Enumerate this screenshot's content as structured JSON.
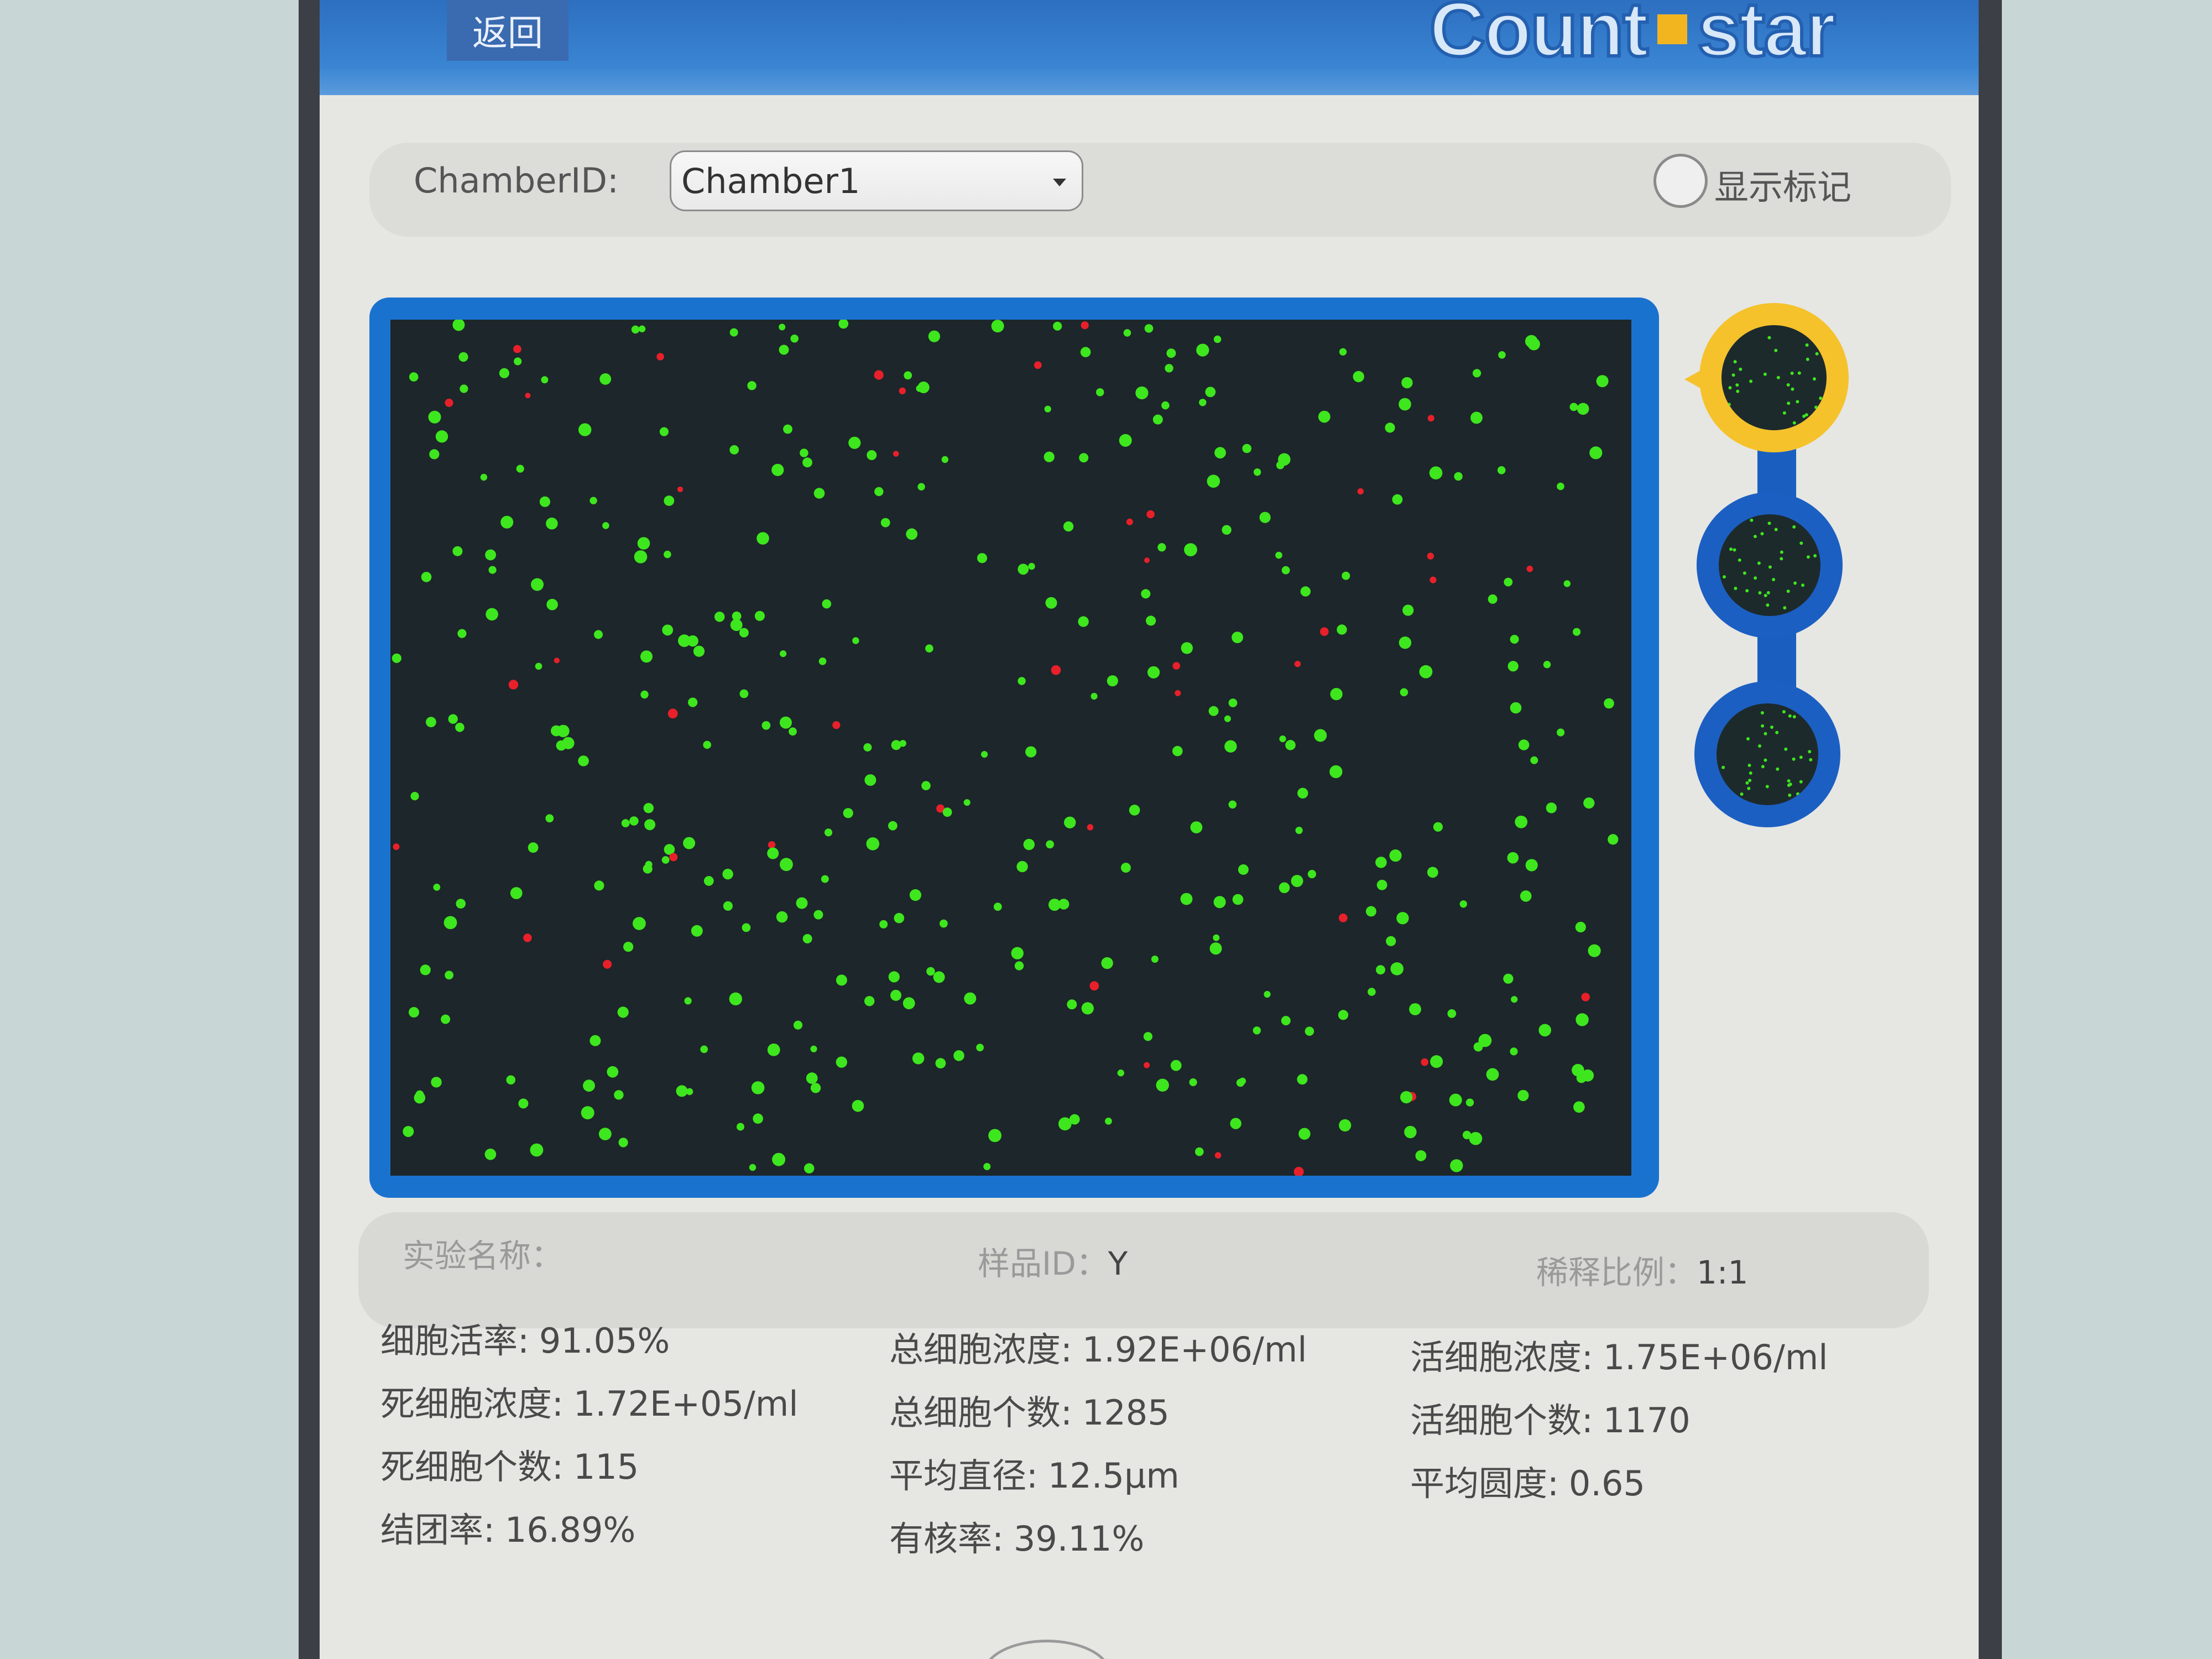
{
  "header": {
    "back_label": "返回",
    "brand_part1": "Count",
    "brand_part2": "star"
  },
  "chamber": {
    "label": "ChamberID:",
    "selected": "Chamber1",
    "show_marks_label": "显示标记",
    "show_marks_checked": false
  },
  "experiment": {
    "name_label": "实验名称：",
    "name_value": "",
    "sample_label": "样品ID：",
    "sample_value": "Y",
    "dilution_label": "稀释比例：",
    "dilution_value": "1:1"
  },
  "results": {
    "col1": [
      {
        "label": "细胞活率:",
        "value": "91.05%"
      },
      {
        "label": "死细胞浓度:",
        "value": "1.72E+05/ml"
      },
      {
        "label": "死细胞个数:",
        "value": "115"
      },
      {
        "label": "结团率:",
        "value": "16.89%"
      }
    ],
    "col2": [
      {
        "label": "总细胞浓度:",
        "value": "1.92E+06/ml"
      },
      {
        "label": "总细胞个数:",
        "value": "1285"
      },
      {
        "label": "平均直径:",
        "value": "12.5μm"
      },
      {
        "label": "有核率:",
        "value": "39.11%"
      }
    ],
    "col3": [
      {
        "label": "活细胞浓度:",
        "value": "1.75E+06/ml"
      },
      {
        "label": "活细胞个数:",
        "value": "1170"
      },
      {
        "label": "平均圆度:",
        "value": "0.65"
      }
    ]
  },
  "colors": {
    "live_cell": "#3ee61e",
    "dead_cell": "#e8202a",
    "accent_blue": "#1a72cf",
    "active_chamber": "#f5c22b"
  }
}
